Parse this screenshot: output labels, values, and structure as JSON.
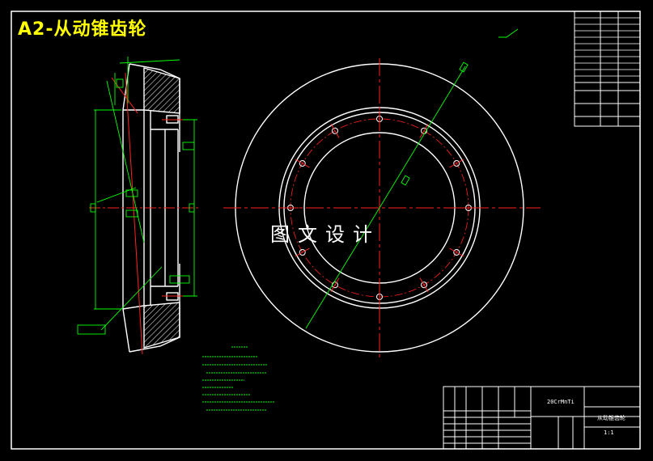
{
  "drawing": {
    "title": "A2-从动锥齿轮",
    "watermark": "图文设计"
  },
  "title_block": {
    "material": "20CrMnTi",
    "part_name": "从动锥齿轮",
    "scale": "1:1"
  },
  "colors": {
    "background": "#000000",
    "outline": "#ffffff",
    "centerline": "#ff2020",
    "dimension": "#00ff00",
    "title": "#ffff00",
    "hatch": "#ffffff"
  }
}
